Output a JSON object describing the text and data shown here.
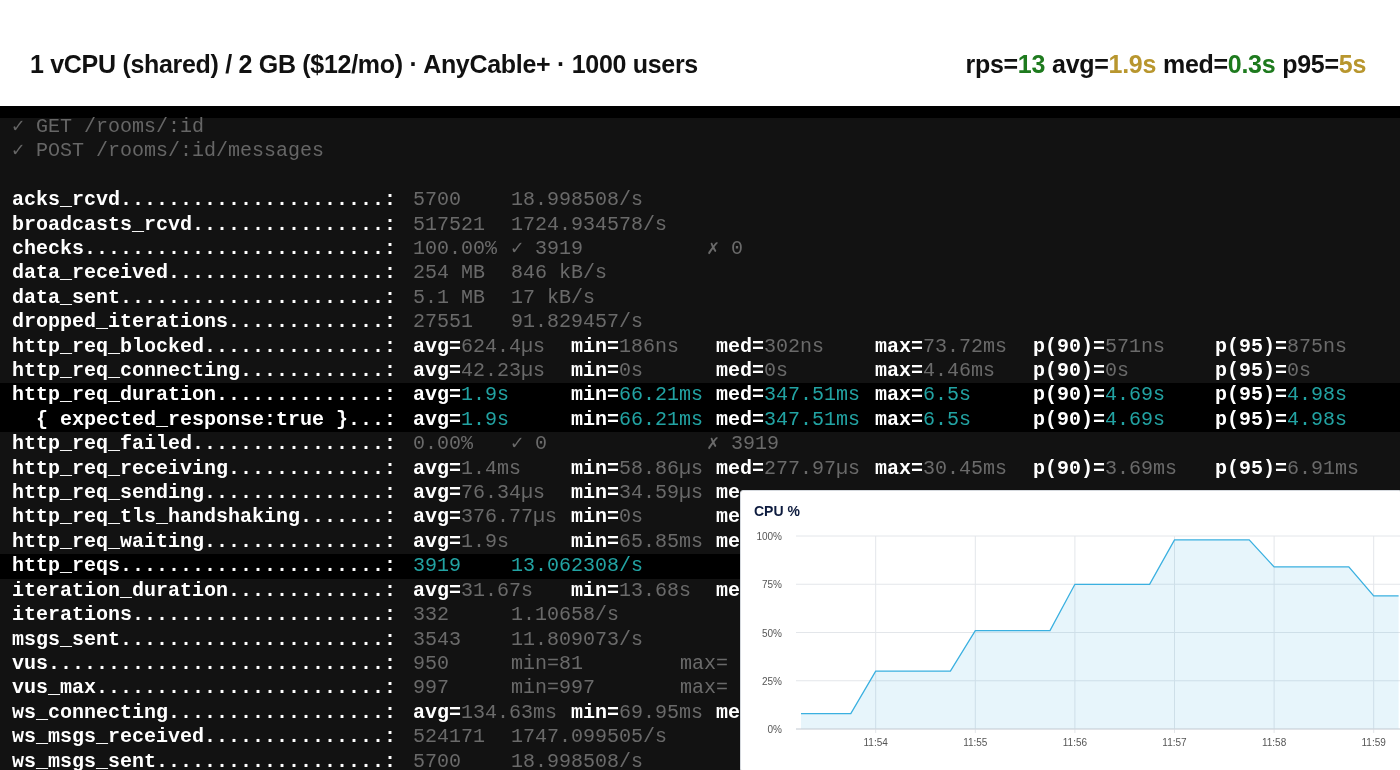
{
  "header": {
    "title": "1 vCPU (shared) / 2 GB ($12/mo) · AnyCable+ · 1000 users",
    "stats": [
      {
        "label": "rps=",
        "value": "13",
        "color": "#1e7a1e"
      },
      {
        "label": "avg=",
        "value": "1.9s",
        "color": "#b8962e"
      },
      {
        "label": "med=",
        "value": "0.3s",
        "color": "#1e7a1e"
      },
      {
        "label": "p95=",
        "value": "5s",
        "color": "#b8962e"
      }
    ]
  },
  "terminal": {
    "check_lines": [
      "✓ GET /rooms/:id",
      "✓ POST /rooms/:id/messages"
    ],
    "metrics": [
      {
        "label": "acks_rcvd......................:",
        "kind": "rate",
        "highlighted": false,
        "color": "#6a6a6a",
        "cells": [
          {
            "value": "5700"
          },
          {
            "value": "18.998508/s"
          }
        ]
      },
      {
        "label": "broadcasts_rcvd................:",
        "kind": "rate",
        "highlighted": false,
        "color": "#6a6a6a",
        "cells": [
          {
            "value": "517521"
          },
          {
            "value": "1724.934578/s"
          }
        ]
      },
      {
        "label": "checks.........................:",
        "kind": "rate",
        "highlighted": false,
        "color": "#6a6a6a",
        "cells": [
          {
            "value": "100.00%"
          },
          {
            "value": "✓ 3919"
          },
          {
            "value": "✗ 0"
          }
        ]
      },
      {
        "label": "data_received..................:",
        "kind": "rate",
        "highlighted": false,
        "color": "#6a6a6a",
        "cells": [
          {
            "value": "254 MB"
          },
          {
            "value": "846 kB/s"
          }
        ]
      },
      {
        "label": "data_sent......................:",
        "kind": "rate",
        "highlighted": false,
        "color": "#6a6a6a",
        "cells": [
          {
            "value": "5.1 MB"
          },
          {
            "value": "17 kB/s"
          }
        ]
      },
      {
        "label": "dropped_iterations.............:",
        "kind": "rate",
        "highlighted": false,
        "color": "#6a6a6a",
        "cells": [
          {
            "value": "27551"
          },
          {
            "value": "91.829457/s"
          }
        ]
      },
      {
        "label": "http_req_blocked...............:",
        "kind": "trend",
        "highlighted": false,
        "color": "#6a6a6a",
        "cells": [
          {
            "label": "avg=",
            "value": "624.4µs"
          },
          {
            "label": "min=",
            "value": "186ns"
          },
          {
            "label": "med=",
            "value": "302ns"
          },
          {
            "label": "max=",
            "value": "73.72ms"
          },
          {
            "label": "p(90)=",
            "value": "571ns"
          },
          {
            "label": "p(95)=",
            "value": "875ns"
          }
        ]
      },
      {
        "label": "http_req_connecting............:",
        "kind": "trend",
        "highlighted": false,
        "color": "#6a6a6a",
        "cells": [
          {
            "label": "avg=",
            "value": "42.23µs"
          },
          {
            "label": "min=",
            "value": "0s"
          },
          {
            "label": "med=",
            "value": "0s"
          },
          {
            "label": "max=",
            "value": "4.46ms"
          },
          {
            "label": "p(90)=",
            "value": "0s"
          },
          {
            "label": "p(95)=",
            "value": "0s"
          }
        ]
      },
      {
        "label": "http_req_duration..............:",
        "kind": "trend",
        "highlighted": true,
        "color": "#22a3a3",
        "cells": [
          {
            "label": "avg=",
            "value": "1.9s"
          },
          {
            "label": "min=",
            "value": "66.21ms"
          },
          {
            "label": "med=",
            "value": "347.51ms"
          },
          {
            "label": "max=",
            "value": "6.5s"
          },
          {
            "label": "p(90)=",
            "value": "4.69s"
          },
          {
            "label": "p(95)=",
            "value": "4.98s"
          }
        ]
      },
      {
        "label": "  { expected_response:true }...:",
        "kind": "trend",
        "highlighted": true,
        "color": "#22a3a3",
        "cells": [
          {
            "label": "avg=",
            "value": "1.9s"
          },
          {
            "label": "min=",
            "value": "66.21ms"
          },
          {
            "label": "med=",
            "value": "347.51ms"
          },
          {
            "label": "max=",
            "value": "6.5s"
          },
          {
            "label": "p(90)=",
            "value": "4.69s"
          },
          {
            "label": "p(95)=",
            "value": "4.98s"
          }
        ]
      },
      {
        "label": "http_req_failed................:",
        "kind": "rate",
        "highlighted": false,
        "color": "#6a6a6a",
        "cells": [
          {
            "value": "0.00%"
          },
          {
            "value": "✓ 0"
          },
          {
            "value": "✗ 3919"
          }
        ]
      },
      {
        "label": "http_req_receiving.............:",
        "kind": "trend",
        "highlighted": false,
        "color": "#6a6a6a",
        "cells": [
          {
            "label": "avg=",
            "value": "1.4ms"
          },
          {
            "label": "min=",
            "value": "58.86µs"
          },
          {
            "label": "med=",
            "value": "277.97µs"
          },
          {
            "label": "max=",
            "value": "30.45ms"
          },
          {
            "label": "p(90)=",
            "value": "3.69ms"
          },
          {
            "label": "p(95)=",
            "value": "6.91ms"
          }
        ]
      },
      {
        "label": "http_req_sending...............:",
        "kind": "trend",
        "highlighted": false,
        "color": "#6a6a6a",
        "cells": [
          {
            "label": "avg=",
            "value": "76.34µs"
          },
          {
            "label": "min=",
            "value": "34.59µs"
          },
          {
            "label": "me"
          }
        ]
      },
      {
        "label": "http_req_tls_handshaking.......:",
        "kind": "trend",
        "highlighted": false,
        "color": "#6a6a6a",
        "cells": [
          {
            "label": "avg=",
            "value": "376.77µs"
          },
          {
            "label": "min=",
            "value": "0s"
          },
          {
            "label": "me"
          }
        ]
      },
      {
        "label": "http_req_waiting...............:",
        "kind": "trend",
        "highlighted": false,
        "color": "#6a6a6a",
        "cells": [
          {
            "label": "avg=",
            "value": "1.9s"
          },
          {
            "label": "min=",
            "value": "65.85ms"
          },
          {
            "label": "me"
          }
        ]
      },
      {
        "label": "http_reqs......................:",
        "kind": "rate",
        "highlighted": true,
        "color": "#22a3a3",
        "cells": [
          {
            "value": "3919"
          },
          {
            "value": "13.062308/s"
          }
        ]
      },
      {
        "label": "iteration_duration.............:",
        "kind": "trend",
        "highlighted": false,
        "color": "#6a6a6a",
        "cells": [
          {
            "label": "avg=",
            "value": "31.67s"
          },
          {
            "label": "min=",
            "value": "13.68s"
          },
          {
            "label": "me"
          }
        ]
      },
      {
        "label": "iterations.....................:",
        "kind": "rate",
        "highlighted": false,
        "color": "#6a6a6a",
        "cells": [
          {
            "value": "332"
          },
          {
            "value": "1.10658/s"
          }
        ]
      },
      {
        "label": "msgs_sent......................:",
        "kind": "rate",
        "highlighted": false,
        "color": "#6a6a6a",
        "cells": [
          {
            "value": "3543"
          },
          {
            "value": "11.809073/s"
          }
        ]
      },
      {
        "label": "vus............................:",
        "kind": "gauge",
        "highlighted": false,
        "color": "#6a6a6a",
        "cells": [
          {
            "value": "950"
          },
          {
            "value": "min=81"
          },
          {
            "value": "max="
          }
        ]
      },
      {
        "label": "vus_max........................:",
        "kind": "gauge",
        "highlighted": false,
        "color": "#6a6a6a",
        "cells": [
          {
            "value": "997"
          },
          {
            "value": "min=997"
          },
          {
            "value": "max="
          }
        ]
      },
      {
        "label": "ws_connecting..................:",
        "kind": "trend",
        "highlighted": false,
        "color": "#6a6a6a",
        "cells": [
          {
            "label": "avg=",
            "value": "134.63ms"
          },
          {
            "label": "min=",
            "value": "69.95ms"
          },
          {
            "label": "me"
          }
        ]
      },
      {
        "label": "ws_msgs_received...............:",
        "kind": "rate",
        "highlighted": false,
        "color": "#6a6a6a",
        "cells": [
          {
            "value": "524171"
          },
          {
            "value": "1747.099505/s"
          }
        ]
      },
      {
        "label": "ws_msgs_sent...................:",
        "kind": "rate",
        "highlighted": false,
        "color": "#6a6a6a",
        "cells": [
          {
            "value": "5700"
          },
          {
            "value": "18.998508/s"
          }
        ]
      }
    ]
  },
  "cpu_panel": {
    "title": "CPU %",
    "chart_data": {
      "type": "area",
      "categories": [
        null,
        null,
        null,
        "11:54",
        null,
        null,
        null,
        "11:55",
        null,
        null,
        null,
        "11:56",
        null,
        null,
        null,
        "11:57",
        null,
        null,
        null,
        "11:58",
        null,
        null,
        null,
        "11:59",
        null
      ],
      "grid": true,
      "series": [
        {
          "color": "#3ab0e0",
          "values": [
            8,
            8,
            8,
            30,
            30,
            30,
            30,
            51,
            51,
            51,
            51,
            75,
            75,
            75,
            75,
            98,
            98,
            98,
            98,
            84,
            84,
            84,
            84,
            69,
            69
          ]
        }
      ],
      "ylim": [
        0,
        100
      ],
      "yticks": [
        {
          "value": 0,
          "label": "0%"
        },
        {
          "value": 25,
          "label": "25%"
        },
        {
          "value": 50,
          "label": "50%"
        },
        {
          "value": 75,
          "label": "75%"
        },
        {
          "value": 100,
          "label": "100%"
        }
      ]
    }
  }
}
